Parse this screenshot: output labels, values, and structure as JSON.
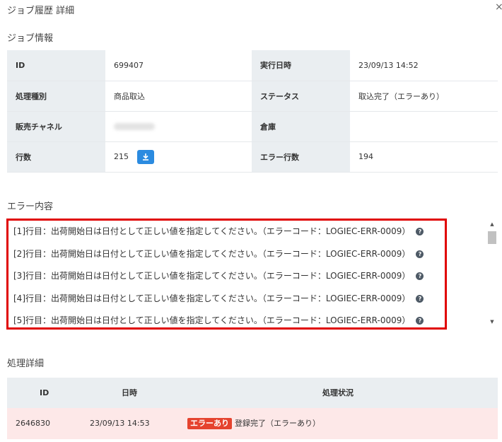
{
  "modal": {
    "title": "ジョブ履歴 詳細",
    "close_glyph": "×"
  },
  "job_info": {
    "heading": "ジョブ情報",
    "rows": [
      {
        "label1": "ID",
        "value1": "699407",
        "label2": "実行日時",
        "value2": "23/09/13 14:52"
      },
      {
        "label1": "処理種別",
        "value1": "商品取込",
        "label2": "ステータス",
        "value2": "取込完了（エラーあり）"
      },
      {
        "label1": "販売チャネル",
        "value1": "",
        "label2": "倉庫",
        "value2": ""
      },
      {
        "label1": "行数",
        "value1": "215",
        "label2": "エラー行数",
        "value2": "194"
      }
    ]
  },
  "errors": {
    "heading": "エラー内容",
    "lines": [
      "[1]行目：出荷開始日は日付として正しい値を指定してください。（エラーコード：LOGIEC-ERR-0009）",
      "[2]行目：出荷開始日は日付として正しい値を指定してください。（エラーコード：LOGIEC-ERR-0009）",
      "[3]行目：出荷開始日は日付として正しい値を指定してください。（エラーコード：LOGIEC-ERR-0009）",
      "[4]行目：出荷開始日は日付として正しい値を指定してください。（エラーコード：LOGIEC-ERR-0009）",
      "[5]行目：出荷開始日は日付として正しい値を指定してください。（エラーコード：LOGIEC-ERR-0009）"
    ],
    "help_glyph": "?"
  },
  "details": {
    "heading": "処理詳細",
    "columns": {
      "id": "ID",
      "datetime": "日時",
      "status": "処理状況"
    },
    "rows": [
      {
        "id": "2646830",
        "datetime": "23/09/13 14:53",
        "badge": "エラーあり",
        "status": "登録完了（エラーあり）"
      }
    ]
  },
  "colors": {
    "highlight_border": "#e00000",
    "badge": "#e5432f",
    "row_error_bg": "#fde8e8",
    "download_button": "#2b8be0"
  }
}
